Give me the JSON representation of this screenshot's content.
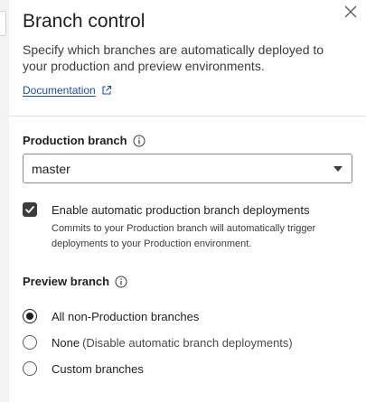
{
  "panel": {
    "title": "Branch control",
    "subtitle": "Specify which branches are automatically deployed to your production and preview environments.",
    "doc_link": "Documentation",
    "close_icon": "close-icon"
  },
  "production": {
    "label": "Production branch",
    "selected_branch": "master",
    "auto_deploy": {
      "checked": true,
      "label": "Enable automatic production branch deployments",
      "description": "Commits to your Production branch will automatically trigger deployments to your Production environment."
    }
  },
  "preview": {
    "label": "Preview branch",
    "options": [
      {
        "label": "All non-Production branches",
        "hint": "",
        "selected": true
      },
      {
        "label": "None",
        "hint": "(Disable automatic branch deployments)",
        "selected": false
      },
      {
        "label": "Custom branches",
        "hint": "",
        "selected": false
      }
    ]
  },
  "colors": {
    "link": "#1f4e9d",
    "checkbox": "#3c3c3c",
    "divider": "#e1e1e1"
  }
}
